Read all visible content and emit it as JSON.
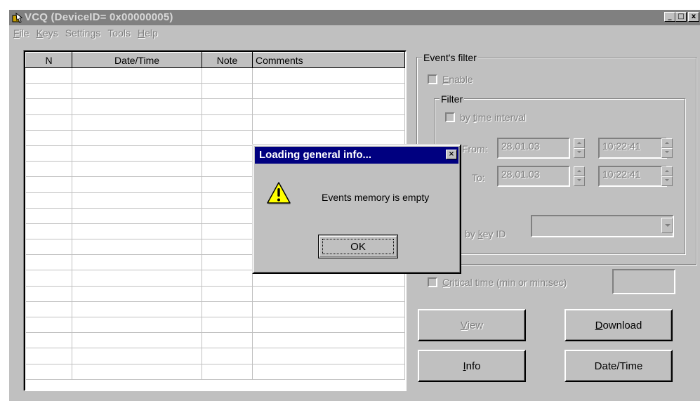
{
  "window": {
    "title": "VCQ (DeviceID= 0x00000005)",
    "controls": [
      "_",
      "□",
      "x"
    ]
  },
  "menu": [
    {
      "label": "File",
      "accel": "F",
      "rest": "ile"
    },
    {
      "label": "Keys",
      "accel": "K",
      "rest": "eys"
    },
    {
      "label": "Settings",
      "accel": "",
      "rest": "Settings"
    },
    {
      "label": "Tools",
      "accel": "",
      "rest": "Tools"
    },
    {
      "label": "Help",
      "accel": "H",
      "rest": "elp"
    }
  ],
  "events_table": {
    "columns": [
      "N",
      "Date/Time",
      "Note",
      "Comments"
    ],
    "rows": []
  },
  "filter": {
    "group_label": "Event's filter",
    "enable_label": "Enable",
    "enable_checked": false,
    "inner_group_label": "Filter",
    "by_time_label": "by time interval",
    "by_time_checked": false,
    "from_label": "From:",
    "to_label": "To:",
    "from_date": "28.01.03",
    "from_time": "10:22:41",
    "to_date": "28.01.03",
    "to_time": "10:22:41",
    "by_key_label": "by key ID",
    "key_id_value": ""
  },
  "critical_time": {
    "label": "Critical time (min or min:sec)",
    "checked": false,
    "value": ""
  },
  "buttons": {
    "view": "View",
    "download": "Download",
    "info": "Info",
    "datetime": "Date/Time"
  },
  "dialog": {
    "title": "Loading general info...",
    "message": "Events memory is empty",
    "ok_label": "OK",
    "icon": "warning-icon"
  },
  "colors": {
    "face": "#c0c0c0",
    "dialog_title": "#000080",
    "disabled_text": "#808080"
  }
}
